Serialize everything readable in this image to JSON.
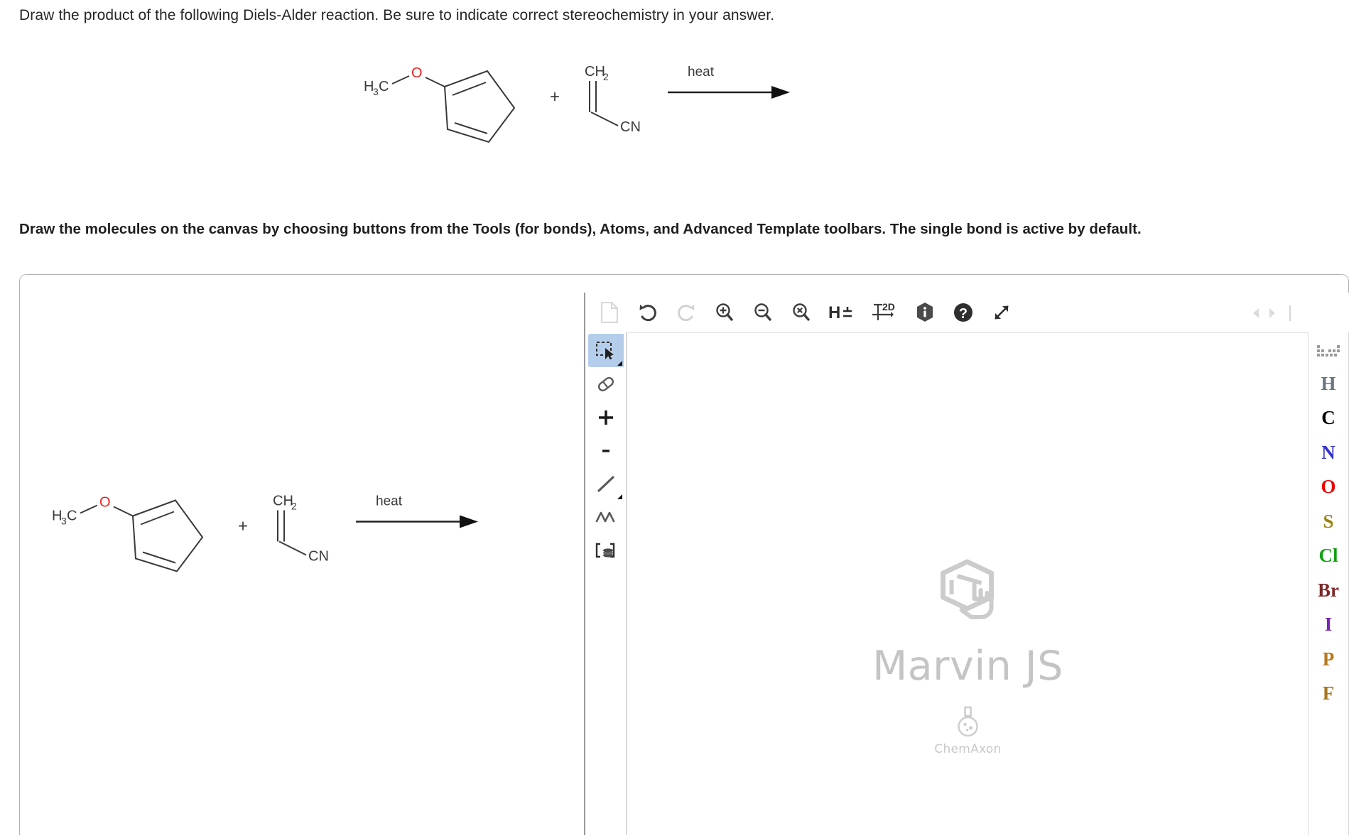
{
  "question": {
    "prompt": "Draw the product of the following Diels-Alder reaction. Be sure to indicate correct stereochemistry in your answer.",
    "instructions": "Draw the molecules on the canvas by choosing buttons from the Tools (for bonds), Atoms, and Advanced Template toolbars. The single bond is active by default."
  },
  "reaction": {
    "reactant1_name": "1-methoxycyclopenta-1,3-diene",
    "methyl_label": "H",
    "methyl_sub": "3",
    "methyl_c": "C",
    "oxygen_label": "O",
    "plus_sign": "+",
    "reactant2_name": "acrylonitrile",
    "ch2_label": "CH",
    "ch2_sub": "2",
    "cn_label": "CN",
    "arrow_condition": "heat",
    "oxygen_color": "#ee2222",
    "bond_color": "#3a3a3a"
  },
  "marvin": {
    "toolbar": [
      {
        "name": "new-document-icon",
        "label": "New"
      },
      {
        "name": "undo-icon",
        "label": "Undo"
      },
      {
        "name": "redo-icon",
        "label": "Redo"
      },
      {
        "name": "zoom-in-icon",
        "label": "Zoom In"
      },
      {
        "name": "zoom-out-icon",
        "label": "Zoom Out"
      },
      {
        "name": "zoom-reset-icon",
        "label": "Reset Zoom"
      },
      {
        "name": "hydrogen-toggle-icon",
        "label": "H±"
      },
      {
        "name": "clean-2d-icon",
        "label": "Clean 2D"
      },
      {
        "name": "info-icon",
        "label": "About"
      },
      {
        "name": "help-icon",
        "label": "Help"
      },
      {
        "name": "fullscreen-icon",
        "label": "Fullscreen"
      }
    ],
    "hydrogen_label": "H",
    "hydrogen_sign": "±",
    "clean2d_label": "2D",
    "nav": {
      "prev": "◀",
      "next": "▶"
    },
    "tools": [
      {
        "name": "selection-tool",
        "label": "Rectangle Selection",
        "active": true
      },
      {
        "name": "eraser-tool",
        "label": "Eraser",
        "active": false
      },
      {
        "name": "increase-charge-tool",
        "label": "Increase Charge",
        "glyph": "+",
        "active": false
      },
      {
        "name": "decrease-charge-tool",
        "label": "Decrease Charge",
        "glyph": "-",
        "active": false
      },
      {
        "name": "single-bond-tool",
        "label": "Single Bond",
        "active": false
      },
      {
        "name": "chain-tool",
        "label": "Chain",
        "active": false
      },
      {
        "name": "template-tool",
        "label": "Advanced Template",
        "active": false
      }
    ],
    "watermark": {
      "title": "Marvin JS",
      "vendor": "ChemAxon"
    },
    "periodic_table_button": "periodic-table-icon",
    "elements": [
      {
        "symbol": "H",
        "color": "#6b7280"
      },
      {
        "symbol": "C",
        "color": "#000000"
      },
      {
        "symbol": "N",
        "color": "#3333cc"
      },
      {
        "symbol": "O",
        "color": "#ee0000"
      },
      {
        "symbol": "S",
        "color": "#9c8417"
      },
      {
        "symbol": "Cl",
        "color": "#12a012"
      },
      {
        "symbol": "Br",
        "color": "#7b2a2a"
      },
      {
        "symbol": "I",
        "color": "#7a24b5"
      },
      {
        "symbol": "P",
        "color": "#b5781a"
      },
      {
        "symbol": "F",
        "color": "#a5751a"
      }
    ]
  }
}
